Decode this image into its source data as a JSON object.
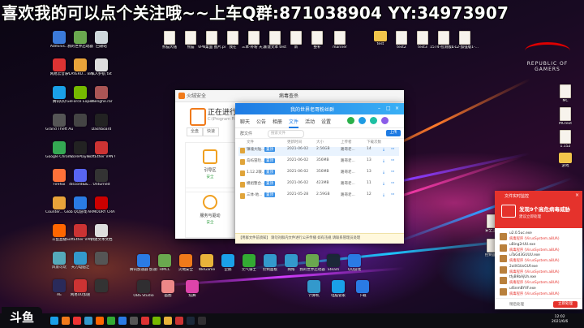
{
  "banner": "喜欢我的可以点个关注哦~~上车Q群:871038904 YY:34973907",
  "rog_logo": [
    "REPUBLIC OF",
    "GAMERS"
  ],
  "desktop_icons_left": [
    {
      "label": "Adminis...",
      "color": "#3b7ad9"
    },
    {
      "label": "我的世界启动器",
      "color": "#6aa84f"
    },
    {
      "label": "回收站",
      "color": "#cfd8dc"
    },
    {
      "label": "网易云音乐",
      "color": "#d33"
    },
    {
      "label": "PLAYERU... BATTLEGR...",
      "color": "#e8a33a"
    },
    {
      "label": "私人护航 txt",
      "color": "#ddd"
    },
    {
      "label": "腾讯QQ",
      "color": "#1aa0e8"
    },
    {
      "label": "GeForce Experience",
      "color": "#76b900"
    },
    {
      "label": "chenghe.rar",
      "color": "#a55"
    },
    {
      "label": "Grand Theft Auto V",
      "color": "#555"
    },
    {
      "label": "",
      "color": "#444"
    },
    {
      "label": "Dashboard",
      "color": "#222"
    },
    {
      "label": "Google Chrome",
      "color": "#34a853"
    },
    {
      "label": "CorePlayer",
      "color": "#222"
    },
    {
      "label": "SoftEther VPN Clie...",
      "color": "#c33"
    },
    {
      "label": "Firefox",
      "color": "#ff7139"
    },
    {
      "label": "discord&&...",
      "color": "#5865f2"
    },
    {
      "label": "Unturned",
      "color": "#333"
    },
    {
      "label": "Counter... Global Of...",
      "color": "#e8a33a"
    },
    {
      "label": "QQ游戏",
      "color": "#2a7be4"
    },
    {
      "label": "ARMOURY CRATE",
      "color": "#c00"
    },
    {
      "label": "斗鱼直播",
      "color": "#f60"
    },
    {
      "label": "SoftEther VPN Serv...",
      "color": "#c33"
    },
    {
      "label": "新建文本文档",
      "color": "#ddd"
    },
    {
      "label": "风景可玩",
      "color": "#5ab"
    },
    {
      "label": "天刀电脑之",
      "color": "#39c"
    },
    {
      "label": "",
      "color": "#555"
    },
    {
      "label": "AE",
      "color": "#2a2a5a"
    },
    {
      "label": "网易UU加速",
      "color": "#c33"
    },
    {
      "label": "",
      "color": "#333"
    }
  ],
  "desktop_icons_top": [
    {
      "label": "熊猫大陆",
      "kind": "file"
    },
    {
      "label": "熊猫",
      "kind": "file"
    },
    {
      "label": "VPN桌面 图片.png",
      "kind": "file"
    },
    {
      "label": "我在",
      "kind": "file"
    },
    {
      "label": "三本-补粉 天刀",
      "kind": "file"
    },
    {
      "label": "新建文本 test",
      "kind": "file"
    },
    {
      "label": "新",
      "kind": "file"
    },
    {
      "label": "整补",
      "kind": "file"
    },
    {
      "label": "mariner",
      "kind": "file"
    },
    {
      "label": "test",
      "kind": "folder"
    },
    {
      "label": "test2",
      "kind": "file"
    },
    {
      "label": "test3",
      "kind": "file"
    },
    {
      "label": "1574-检测版1-...On",
      "kind": "file"
    },
    {
      "label": "1.12-加强版1-...",
      "kind": "file"
    }
  ],
  "desktop_icons_bottom": [
    {
      "label": "腾讯加速器 加速版",
      "color": "#2a7be4"
    },
    {
      "label": "HMCL",
      "color": "#6aa84f"
    },
    {
      "label": "火绒安全",
      "color": "#f07a1a"
    },
    {
      "label": "WeGame",
      "color": "#e8b33a"
    },
    {
      "label": "企鹅",
      "color": "#1aa0e8"
    },
    {
      "label": "元气骑士",
      "color": "#3a3"
    },
    {
      "label": "控制面板",
      "color": "#39c"
    },
    {
      "label": "网络",
      "color": "#39c"
    },
    {
      "label": "我的世界启动器",
      "color": "#6aa84f"
    },
    {
      "label": "Steam",
      "color": "#1b2838"
    },
    {
      "label": "QQ游戏",
      "color": "#2a7be4"
    },
    {
      "label": "OBS Studio",
      "color": "#302e31"
    },
    {
      "label": "画图",
      "color": "#e88"
    },
    {
      "label": "炫舞",
      "color": "#d4a"
    },
    {
      "label": "计算机",
      "color": "#39c"
    },
    {
      "label": "电脑管家",
      "color": "#1aa0e8"
    },
    {
      "label": "下载",
      "color": "#2a7be4"
    }
  ],
  "desktop_icons_right": [
    {
      "label": "MC",
      "kind": "file"
    },
    {
      "label": "MCtext",
      "kind": "file"
    },
    {
      "label": "1.152",
      "kind": "file"
    },
    {
      "label": "游戏",
      "kind": "folder"
    },
    {
      "label": "安全卫士",
      "kind": "file"
    },
    {
      "label": "控制面板",
      "kind": "file"
    }
  ],
  "huorong": {
    "window_title": "火绒安全",
    "dialog_title": "病毒查杀",
    "scan_title": "正在进行全",
    "scan_path": "C:\\Program Files",
    "segments": [
      "全盘",
      "快速"
    ],
    "tiles": [
      {
        "label": "引导区",
        "status": "安全"
      },
      {
        "label": "服务与驱动",
        "status": "安全"
      }
    ]
  },
  "qq": {
    "title": "我的世界老哥粉丝群",
    "tabs": [
      "聊天",
      "公告",
      "相册",
      "文件",
      "活动",
      "设置"
    ],
    "active_tab": "文件",
    "file_count": "群文件",
    "search_placeholder": "搜索文件",
    "upload_label": "上传",
    "columns": [
      "文件",
      "更新时间",
      "大小",
      "上传者",
      "下载次数"
    ],
    "files": [
      {
        "name": "镇魂大陆...",
        "time": "2021-06-02",
        "size": "2.56GB",
        "uploader": "路哥老...",
        "downloads": "14",
        "tag": "置顶"
      },
      {
        "name": "岛屿冒险...",
        "time": "2021-06-02",
        "size": "356MB",
        "uploader": "路哥老...",
        "downloads": "13",
        "tag": "置顶"
      },
      {
        "name": "1.12.2联...",
        "time": "2021-06-02",
        "size": "356MB",
        "uploader": "路哥老...",
        "downloads": "13",
        "tag": "置顶"
      },
      {
        "name": "模组整合...",
        "time": "2021-06-02",
        "size": "423MB",
        "uploader": "路哥老...",
        "downloads": "11",
        "tag": "置顶"
      },
      {
        "name": "三体-地...",
        "time": "2021-05-28",
        "size": "2.59GB",
        "uploader": "路哥老...",
        "downloads": "12",
        "tag": "置顶"
      }
    ],
    "notice": "【用群文件前须知】 请勿对群内文件进行公开传播 如有违规 请联系管理员处理"
  },
  "alert": {
    "header": "文件实时监控",
    "headline": "发现9个高危病毒威胁",
    "sub": "建议立即处理",
    "items": [
      {
        "file": "u2.0.5uc.exe",
        "threat": "病毒程序 (VirusSystem.a8UA)"
      },
      {
        "file": "uBing2rUU.exe",
        "threat": "病毒程序 (VirusSystem.a8UA)"
      },
      {
        "file": "uTaGd3GUUU.exe",
        "threat": "病毒程序 (VirusSystem.a8UA)"
      },
      {
        "file": "2oIXGUsGUf.exe",
        "threat": "病毒程序 (VirusSystem.a8UA)"
      },
      {
        "file": "tfyB9bAjUh.exe",
        "threat": "病毒程序 (VirusSystem.a8UA)"
      },
      {
        "file": "uISnmBYVF.exe",
        "threat": "病毒程序 (VirusSystem.a8UA)"
      }
    ],
    "later_label": "稍后处理",
    "action_label": "立即处理"
  },
  "taskbar": {
    "clock_time": "12:02",
    "clock_date": "2021/6/6",
    "app_colors": [
      "#1aa0e8",
      "#f07a1a",
      "#e33",
      "#39c",
      "#f60",
      "#3a3",
      "#2a7be4",
      "#555",
      "#d33",
      "#76b900",
      "#e8b33a",
      "#c33",
      "#1b2838",
      "#302e31"
    ]
  },
  "watermark": "斗鱼"
}
